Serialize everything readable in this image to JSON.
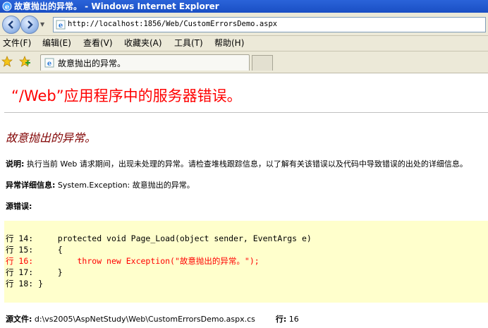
{
  "window": {
    "title": "故意抛出的异常。 - Windows Internet Explorer"
  },
  "address_bar": {
    "url": "http://localhost:1856/Web/CustomErrorsDemo.aspx"
  },
  "menu": [
    {
      "label": "文件(F)"
    },
    {
      "label": "编辑(E)"
    },
    {
      "label": "查看(V)"
    },
    {
      "label": "收藏夹(A)"
    },
    {
      "label": "工具(T)"
    },
    {
      "label": "帮助(H)"
    }
  ],
  "tab": {
    "title": "故意抛出的异常。"
  },
  "page": {
    "heading": "“/Web”应用程序中的服务器错误。",
    "error_message": "故意抛出的异常。",
    "description_label": "说明:",
    "description_text": "执行当前 Web 请求期间，出现未处理的异常。请检查堆栈跟踪信息，以了解有关该错误以及代码中导致错误的出处的详细信息。",
    "exception_label": "异常详细信息:",
    "exception_text": "System.Exception: 故意抛出的异常。",
    "source_error_label": "源错误:",
    "code_lines": [
      {
        "text": "行 14:     protected void Page_Load(object sender, EventArgs e)",
        "error": false
      },
      {
        "text": "行 15:     {",
        "error": false
      },
      {
        "text": "行 16:         throw new Exception(\"故意抛出的异常。\");",
        "error": true
      },
      {
        "text": "行 17:     }",
        "error": false
      },
      {
        "text": "行 18: }",
        "error": false
      }
    ],
    "source_file_label": "源文件:",
    "source_file_path": "d:\\vs2005\\AspNetStudy\\Web\\CustomErrorsDemo.aspx.cs",
    "line_label": "行:",
    "line_number": "16"
  },
  "colors": {
    "heading": "#ff0000",
    "error_message": "#800000",
    "code_background": "#ffffcc",
    "error_line": "#ff0000",
    "title_bar": "#1a4fc4"
  }
}
